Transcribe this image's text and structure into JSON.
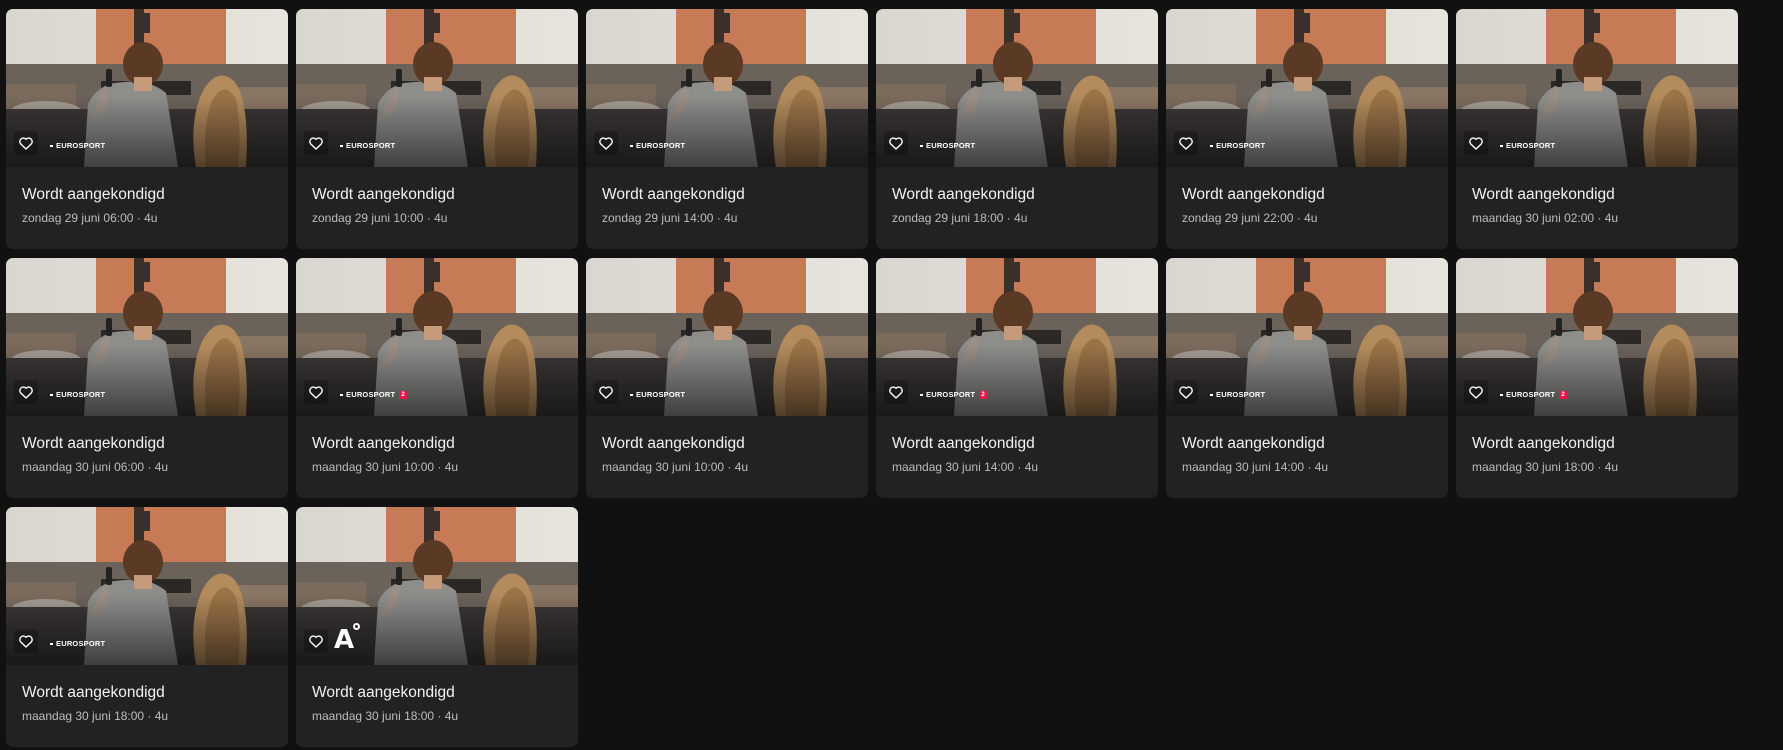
{
  "colors": {
    "background": "#111111",
    "card": "#222222",
    "title_text": "#f2f2f2",
    "meta_text": "#bdbdbd",
    "eurosport2_accent": "#e8174b"
  },
  "icons": {
    "favorite": "heart-outline-icon"
  },
  "cards": [
    {
      "title": "Wordt aangekondigd",
      "meta": "zondag 29 juni 06:00 · 4u",
      "channel": "EUROSPORT",
      "channel_badge": ""
    },
    {
      "title": "Wordt aangekondigd",
      "meta": "zondag 29 juni 10:00 · 4u",
      "channel": "EUROSPORT",
      "channel_badge": ""
    },
    {
      "title": "Wordt aangekondigd",
      "meta": "zondag 29 juni 14:00 · 4u",
      "channel": "EUROSPORT",
      "channel_badge": ""
    },
    {
      "title": "Wordt aangekondigd",
      "meta": "zondag 29 juni 18:00 · 4u",
      "channel": "EUROSPORT",
      "channel_badge": ""
    },
    {
      "title": "Wordt aangekondigd",
      "meta": "zondag 29 juni 22:00 · 4u",
      "channel": "EUROSPORT",
      "channel_badge": ""
    },
    {
      "title": "Wordt aangekondigd",
      "meta": "maandag 30 juni 02:00 · 4u",
      "channel": "EUROSPORT",
      "channel_badge": ""
    },
    {
      "title": "Wordt aangekondigd",
      "meta": "maandag 30 juni 06:00 · 4u",
      "channel": "EUROSPORT",
      "channel_badge": ""
    },
    {
      "title": "Wordt aangekondigd",
      "meta": "maandag 30 juni 10:00 · 4u",
      "channel": "EUROSPORT",
      "channel_badge": "2"
    },
    {
      "title": "Wordt aangekondigd",
      "meta": "maandag 30 juni 10:00 · 4u",
      "channel": "EUROSPORT",
      "channel_badge": ""
    },
    {
      "title": "Wordt aangekondigd",
      "meta": "maandag 30 juni 14:00 · 4u",
      "channel": "EUROSPORT",
      "channel_badge": "2"
    },
    {
      "title": "Wordt aangekondigd",
      "meta": "maandag 30 juni 14:00 · 4u",
      "channel": "EUROSPORT",
      "channel_badge": ""
    },
    {
      "title": "Wordt aangekondigd",
      "meta": "maandag 30 juni 18:00 · 4u",
      "channel": "EUROSPORT",
      "channel_badge": "2"
    },
    {
      "title": "Wordt aangekondigd",
      "meta": "maandag 30 juni 18:00 · 4u",
      "channel": "EUROSPORT",
      "channel_badge": ""
    },
    {
      "title": "Wordt aangekondigd",
      "meta": "maandag 30 juni 18:00 · 4u",
      "channel": "A",
      "channel_badge": ""
    }
  ]
}
